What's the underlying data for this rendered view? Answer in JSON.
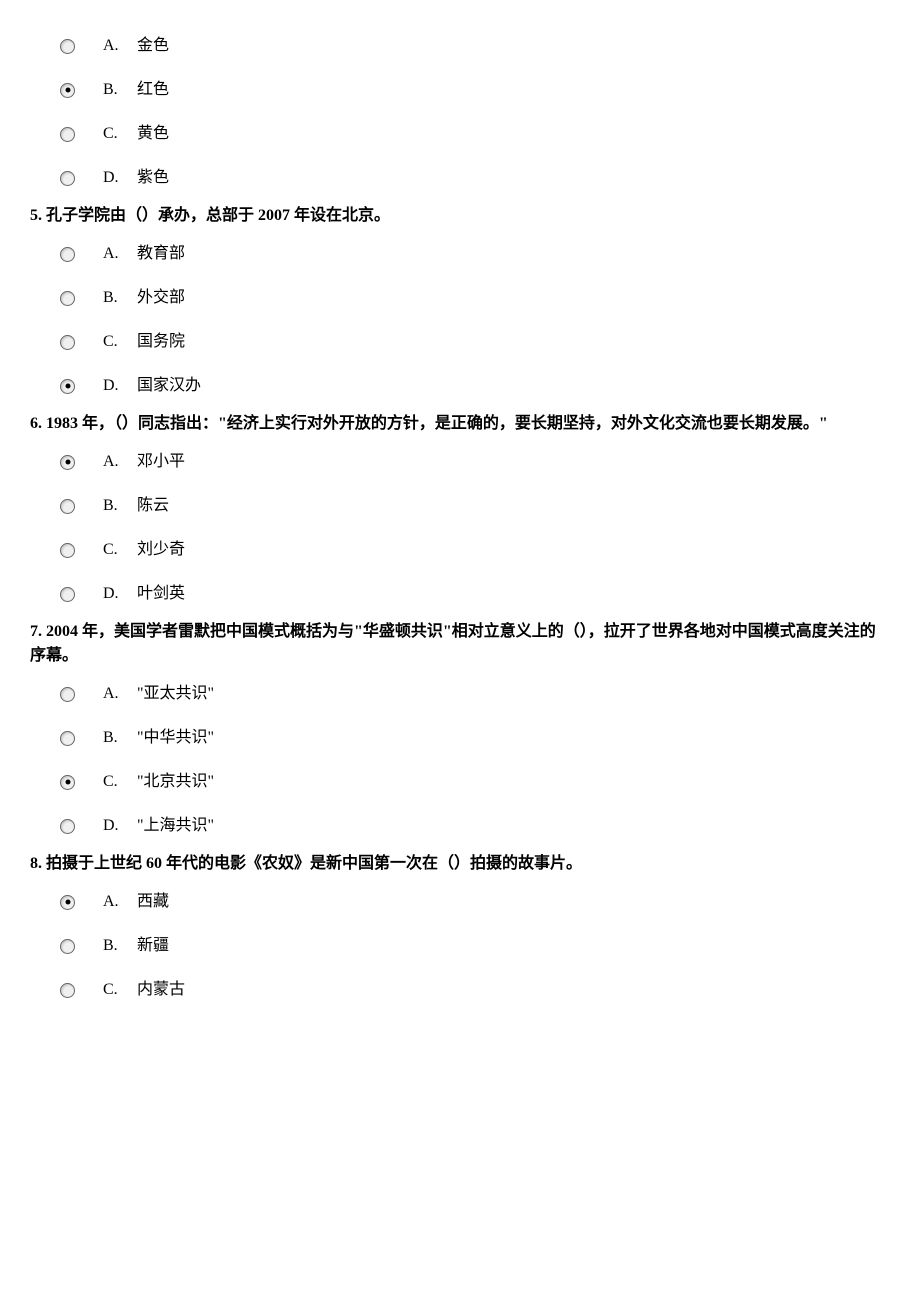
{
  "questions": [
    {
      "number": "",
      "text": "",
      "selected": "B",
      "options": [
        {
          "letter": "A.",
          "label": "金色"
        },
        {
          "letter": "B.",
          "label": "红色"
        },
        {
          "letter": "C.",
          "label": "黄色"
        },
        {
          "letter": "D.",
          "label": "紫色"
        }
      ]
    },
    {
      "number": "5.",
      "text": "孔子学院由（）承办，总部于 2007 年设在北京。",
      "selected": "D",
      "options": [
        {
          "letter": "A.",
          "label": "教育部"
        },
        {
          "letter": "B.",
          "label": "外交部"
        },
        {
          "letter": "C.",
          "label": "国务院"
        },
        {
          "letter": "D.",
          "label": "国家汉办"
        }
      ]
    },
    {
      "number": "6.",
      "text": "1983 年，（）同志指出：\"经济上实行对外开放的方针，是正确的，要长期坚持，对外文化交流也要长期发展。\"",
      "selected": "A",
      "options": [
        {
          "letter": "A.",
          "label": "邓小平"
        },
        {
          "letter": "B.",
          "label": "陈云"
        },
        {
          "letter": "C.",
          "label": "刘少奇"
        },
        {
          "letter": "D.",
          "label": "叶剑英"
        }
      ]
    },
    {
      "number": "7.",
      "text": "2004 年，美国学者雷默把中国模式概括为与\"华盛顿共识\"相对立意义上的（），拉开了世界各地对中国模式高度关注的序幕。",
      "selected": "C",
      "options": [
        {
          "letter": "A.",
          "label": "\"亚太共识\""
        },
        {
          "letter": "B.",
          "label": "\"中华共识\""
        },
        {
          "letter": "C.",
          "label": "\"北京共识\""
        },
        {
          "letter": "D.",
          "label": "\"上海共识\""
        }
      ]
    },
    {
      "number": "8.",
      "text": "拍摄于上世纪 60 年代的电影《农奴》是新中国第一次在（）拍摄的故事片。",
      "selected": "A",
      "options": [
        {
          "letter": "A.",
          "label": "西藏"
        },
        {
          "letter": "B.",
          "label": "新疆"
        },
        {
          "letter": "C.",
          "label": "内蒙古"
        }
      ]
    }
  ]
}
